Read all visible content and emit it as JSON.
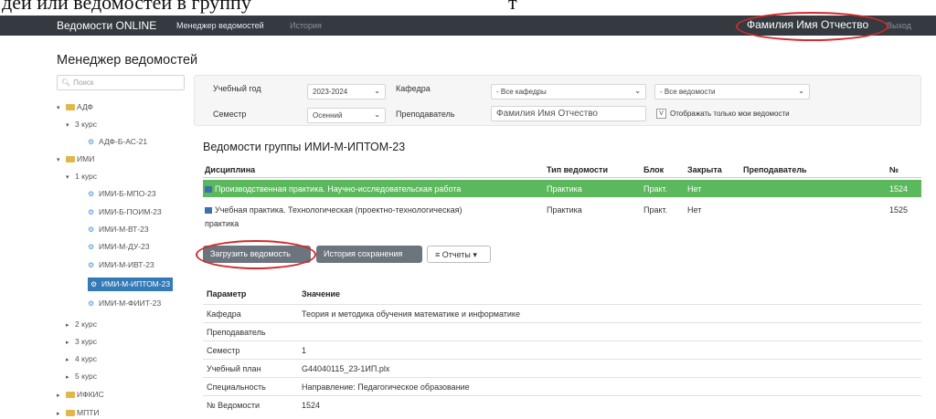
{
  "doc_text": {
    "left": "дей или ведомостей в группу",
    "tail": "т"
  },
  "navbar": {
    "brand": "Ведомости ONLINE",
    "manager": "Менеджер ведомостей",
    "history": "История",
    "user": "Фамилия Имя Отчество",
    "exit": "Выход"
  },
  "page_title": "Менеджер ведомостей",
  "sidebar": {
    "search_placeholder": "Поиск",
    "tree": [
      {
        "label": "АДФ",
        "kind": "folder",
        "toggle": "▾"
      },
      {
        "label": "3 курс",
        "kind": "course",
        "toggle": "▾"
      },
      {
        "label": "АДФ-Б-АС-21",
        "kind": "group"
      },
      {
        "label": "ИМИ",
        "kind": "folder",
        "toggle": "▾"
      },
      {
        "label": "1 курс",
        "kind": "course",
        "toggle": "▾"
      },
      {
        "label": "ИМИ-Б-МПО-23",
        "kind": "group"
      },
      {
        "label": "ИМИ-Б-ПОИМ-23",
        "kind": "group"
      },
      {
        "label": "ИМИ-М-ВТ-23",
        "kind": "group"
      },
      {
        "label": "ИМИ-М-ДУ-23",
        "kind": "group"
      },
      {
        "label": "ИМИ-М-ИВТ-23",
        "kind": "group"
      },
      {
        "label": "ИМИ-М-ИПТОМ-23",
        "kind": "group",
        "active": true
      },
      {
        "label": "ИМИ-М-ФИИТ-23",
        "kind": "group"
      },
      {
        "label": "2 курс",
        "kind": "course",
        "toggle": "▸"
      },
      {
        "label": "3 курс",
        "kind": "course",
        "toggle": "▸"
      },
      {
        "label": "4 курс",
        "kind": "course",
        "toggle": "▸"
      },
      {
        "label": "5 курс",
        "kind": "course",
        "toggle": "▸"
      },
      {
        "label": "ИФКИС",
        "kind": "folder",
        "toggle": "▸"
      },
      {
        "label": "МПТИ",
        "kind": "folder",
        "toggle": "▸"
      }
    ]
  },
  "filters": {
    "year_label": "Учебный год",
    "year_value": "2023-2024",
    "dept_label": "Кафедра",
    "dept_value": "- Все кафедры",
    "statements_value": "- Все ведомости",
    "semester_label": "Семестр",
    "semester_value": "Осенний",
    "teacher_label": "Преподаватель",
    "teacher_value": "Фамилия Имя Отчество",
    "only_mine_mark": "V",
    "only_mine_label": "Отображать только мои ведомости"
  },
  "group_title": "Ведомости группы ИМИ-М-ИПТОМ-23",
  "statements_table": {
    "headers": [
      "Дисциплина",
      "Тип ведомости",
      "Блок",
      "Закрыта",
      "Преподаватель",
      "№"
    ],
    "rows": [
      {
        "discipline": "Производственная практика. Научно-исследовательская работа",
        "type": "Практика",
        "block": "Практ.",
        "closed": "Нет",
        "teacher": "",
        "num": "1524"
      },
      {
        "discipline_line1": "Учебная практика. Технологическая (проектно-технологическая)",
        "discipline_line2": "практика",
        "type": "Практика",
        "block": "Практ.",
        "closed": "Нет",
        "teacher": "",
        "num": "1525"
      }
    ]
  },
  "buttons": {
    "load": "Загрузить ведомость",
    "history": "История сохранения",
    "reports": "Отчеты"
  },
  "params_table": {
    "headers": [
      "Параметр",
      "Значение"
    ],
    "rows": [
      {
        "key": "Кафедра",
        "value": "Теория и методика обучения математике и информатике"
      },
      {
        "key": "Преподаватель",
        "value": ""
      },
      {
        "key": "Семестр",
        "value": "1"
      },
      {
        "key": "Учебный план",
        "value": "G44040115_23-1ИП.plx"
      },
      {
        "key": "Специальность",
        "value": "Направление: Педагогическое образование"
      },
      {
        "key": "№ Ведомости",
        "value": "1524"
      }
    ]
  },
  "colors": {
    "navbar": "#343a40",
    "active_row": "#5cb85c",
    "tree_active": "#337ab7",
    "highlight_oval": "#d42a2a"
  }
}
